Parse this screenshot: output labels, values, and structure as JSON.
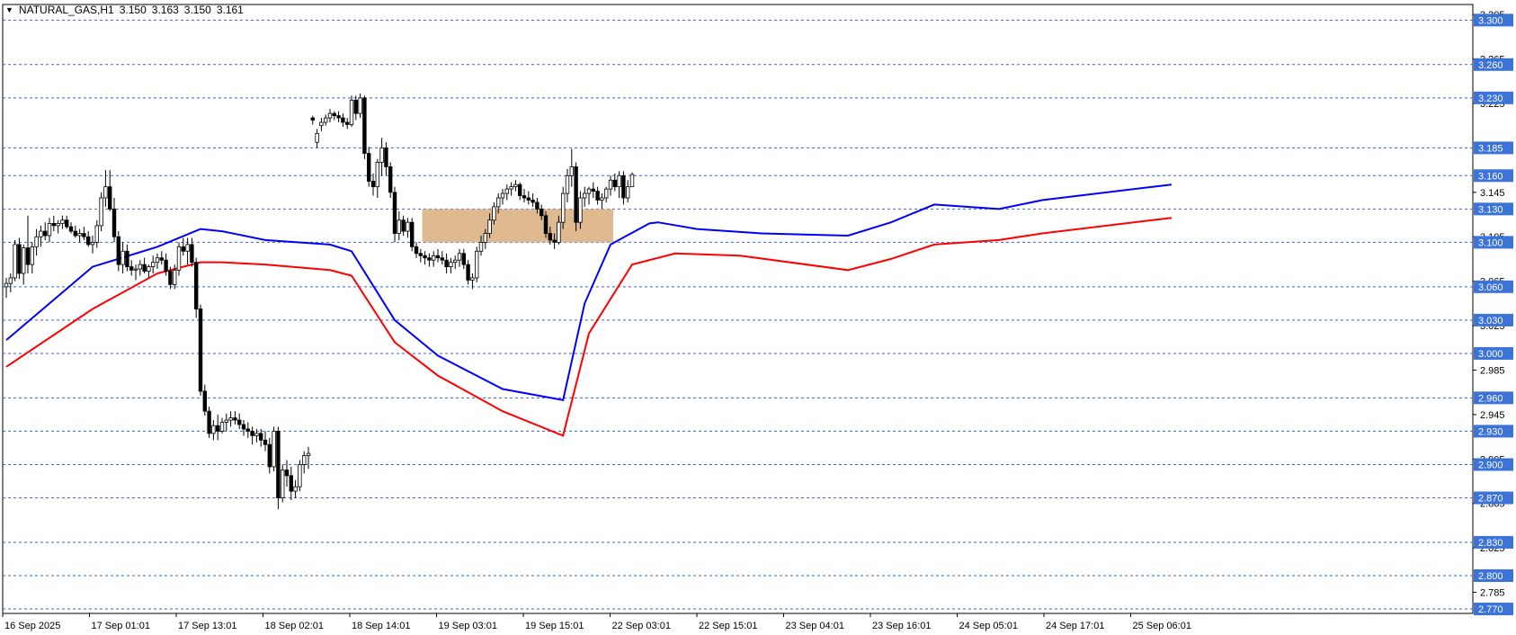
{
  "header": {
    "symbol": "NATURAL_GAS,H1",
    "open": "3.150",
    "high": "3.163",
    "low": "3.150",
    "close": "3.161"
  },
  "colors": {
    "background": "#ffffff",
    "candle_up_fill": "#ffffff",
    "candle_down_fill": "#000000",
    "candle_border": "#000000",
    "ema_fast": "#0000ff",
    "ema_slow": "#ff0000",
    "level_line": "#3b62c7",
    "level_label_bg": "#3b73d9",
    "zone_fill": "#d9ae7c"
  },
  "chart_data": {
    "type": "candlestick",
    "timeframe": "H1",
    "ylim": [
      2.766,
      3.31
    ],
    "y_ticks": [
      "3.305",
      "3.265",
      "3.225",
      "3.145",
      "3.105",
      "3.065",
      "3.025",
      "2.985",
      "2.945",
      "2.905",
      "2.865",
      "2.825",
      "2.785"
    ],
    "levels": [
      "3.300",
      "3.260",
      "3.230",
      "3.185",
      "3.160",
      "3.130",
      "3.100",
      "3.060",
      "3.030",
      "3.000",
      "2.960",
      "2.930",
      "2.900",
      "2.870",
      "2.830",
      "2.800",
      "2.770"
    ],
    "x_tick_labels": [
      "16 Sep 2025",
      "17 Sep 01:01",
      "17 Sep 13:01",
      "18 Sep 02:01",
      "18 Sep 14:01",
      "19 Sep 03:01",
      "19 Sep 15:01",
      "22 Sep 03:01",
      "22 Sep 15:01",
      "23 Sep 04:01",
      "23 Sep 16:01",
      "24 Sep 05:01",
      "24 Sep 17:01",
      "25 Sep 06:01"
    ],
    "zone": {
      "low": 3.1,
      "high": 3.13,
      "start_bar": 97,
      "end_bar": 140
    },
    "candles": [
      [
        3.06,
        3.068,
        3.05,
        3.063
      ],
      [
        3.063,
        3.072,
        3.055,
        3.068
      ],
      [
        3.068,
        3.102,
        3.065,
        3.098
      ],
      [
        3.098,
        3.104,
        3.067,
        3.072
      ],
      [
        3.072,
        3.098,
        3.062,
        3.095
      ],
      [
        3.095,
        3.124,
        3.072,
        3.08
      ],
      [
        3.08,
        3.1,
        3.072,
        3.096
      ],
      [
        3.096,
        3.112,
        3.088,
        3.105
      ],
      [
        3.105,
        3.115,
        3.096,
        3.11
      ],
      [
        3.11,
        3.118,
        3.102,
        3.106
      ],
      [
        3.106,
        3.122,
        3.1,
        3.117
      ],
      [
        3.117,
        3.124,
        3.11,
        3.115
      ],
      [
        3.115,
        3.12,
        3.108,
        3.117
      ],
      [
        3.117,
        3.124,
        3.112,
        3.12
      ],
      [
        3.12,
        3.124,
        3.112,
        3.114
      ],
      [
        3.114,
        3.118,
        3.108,
        3.11
      ],
      [
        3.11,
        3.115,
        3.104,
        3.106
      ],
      [
        3.106,
        3.112,
        3.1,
        3.108
      ],
      [
        3.108,
        3.114,
        3.102,
        3.105
      ],
      [
        3.105,
        3.11,
        3.096,
        3.098
      ],
      [
        3.098,
        3.106,
        3.09,
        3.1
      ],
      [
        3.1,
        3.12,
        3.095,
        3.115
      ],
      [
        3.115,
        3.145,
        3.11,
        3.14
      ],
      [
        3.14,
        3.165,
        3.132,
        3.15
      ],
      [
        3.15,
        3.165,
        3.128,
        3.13
      ],
      [
        3.13,
        3.14,
        3.1,
        3.105
      ],
      [
        3.105,
        3.11,
        3.074,
        3.08
      ],
      [
        3.08,
        3.1,
        3.072,
        3.092
      ],
      [
        3.092,
        3.098,
        3.074,
        3.078
      ],
      [
        3.078,
        3.084,
        3.07,
        3.075
      ],
      [
        3.075,
        3.08,
        3.066,
        3.076
      ],
      [
        3.076,
        3.084,
        3.07,
        3.08
      ],
      [
        3.08,
        3.086,
        3.072,
        3.074
      ],
      [
        3.074,
        3.08,
        3.068,
        3.078
      ],
      [
        3.078,
        3.088,
        3.072,
        3.082
      ],
      [
        3.082,
        3.09,
        3.076,
        3.086
      ],
      [
        3.086,
        3.092,
        3.08,
        3.084
      ],
      [
        3.084,
        3.09,
        3.07,
        3.074
      ],
      [
        3.074,
        3.078,
        3.058,
        3.062
      ],
      [
        3.062,
        3.08,
        3.058,
        3.075
      ],
      [
        3.075,
        3.1,
        3.07,
        3.096
      ],
      [
        3.096,
        3.104,
        3.088,
        3.092
      ],
      [
        3.092,
        3.104,
        3.08,
        3.098
      ],
      [
        3.098,
        3.104,
        3.078,
        3.082
      ],
      [
        3.082,
        3.086,
        3.032,
        3.04
      ],
      [
        3.04,
        3.044,
        2.962,
        2.966
      ],
      [
        2.966,
        2.972,
        2.944,
        2.948
      ],
      [
        2.948,
        2.952,
        2.924,
        2.928
      ],
      [
        2.928,
        2.94,
        2.922,
        2.935
      ],
      [
        2.935,
        2.945,
        2.922,
        2.93
      ],
      [
        2.93,
        2.942,
        2.928,
        2.938
      ],
      [
        2.938,
        2.946,
        2.93,
        2.94
      ],
      [
        2.94,
        2.948,
        2.934,
        2.942
      ],
      [
        2.942,
        2.948,
        2.936,
        2.94
      ],
      [
        2.94,
        2.946,
        2.932,
        2.936
      ],
      [
        2.936,
        2.94,
        2.926,
        2.932
      ],
      [
        2.932,
        2.938,
        2.924,
        2.93
      ],
      [
        2.93,
        2.934,
        2.918,
        2.926
      ],
      [
        2.926,
        2.932,
        2.92,
        2.928
      ],
      [
        2.928,
        2.932,
        2.916,
        2.922
      ],
      [
        2.922,
        2.93,
        2.912,
        2.918
      ],
      [
        2.918,
        2.924,
        2.892,
        2.898
      ],
      [
        2.898,
        2.934,
        2.894,
        2.93
      ],
      [
        2.93,
        2.934,
        2.86,
        2.87
      ],
      [
        2.87,
        2.9,
        2.866,
        2.895
      ],
      [
        2.895,
        2.904,
        2.88,
        2.89
      ],
      [
        2.89,
        2.898,
        2.868,
        2.876
      ],
      [
        2.876,
        2.886,
        2.87,
        2.88
      ],
      [
        2.88,
        2.904,
        2.876,
        2.9
      ],
      [
        2.9,
        2.912,
        2.892,
        2.908
      ],
      [
        2.908,
        2.916,
        2.896,
        2.91
      ],
      [
        3.212,
        3.214,
        3.206,
        3.21
      ],
      [
        3.19,
        3.202,
        3.185,
        3.198
      ],
      [
        3.205,
        3.212,
        3.2,
        3.208
      ],
      [
        3.208,
        3.215,
        3.205,
        3.212
      ],
      [
        3.212,
        3.22,
        3.208,
        3.216
      ],
      [
        3.216,
        3.218,
        3.21,
        3.214
      ],
      [
        3.214,
        3.218,
        3.208,
        3.212
      ],
      [
        3.212,
        3.216,
        3.204,
        3.208
      ],
      [
        3.208,
        3.212,
        3.202,
        3.206
      ],
      [
        3.206,
        3.232,
        3.204,
        3.228
      ],
      [
        3.228,
        3.232,
        3.21,
        3.216
      ],
      [
        3.216,
        3.234,
        3.212,
        3.23
      ],
      [
        3.23,
        3.232,
        3.175,
        3.18
      ],
      [
        3.18,
        3.186,
        3.15,
        3.155
      ],
      [
        3.155,
        3.162,
        3.142,
        3.15
      ],
      [
        3.15,
        3.175,
        3.14,
        3.172
      ],
      [
        3.172,
        3.194,
        3.16,
        3.185
      ],
      [
        3.185,
        3.19,
        3.16,
        3.168
      ],
      [
        3.168,
        3.172,
        3.14,
        3.145
      ],
      [
        3.145,
        3.15,
        3.1,
        3.108
      ],
      [
        3.108,
        3.128,
        3.102,
        3.12
      ],
      [
        3.12,
        3.124,
        3.106,
        3.11
      ],
      [
        3.11,
        3.122,
        3.104,
        3.118
      ],
      [
        3.118,
        3.122,
        3.092,
        3.096
      ],
      [
        3.096,
        3.1,
        3.086,
        3.09
      ],
      [
        3.09,
        3.094,
        3.082,
        3.088
      ],
      [
        3.088,
        3.092,
        3.08,
        3.086
      ],
      [
        3.086,
        3.09,
        3.078,
        3.084
      ],
      [
        3.084,
        3.092,
        3.078,
        3.088
      ],
      [
        3.088,
        3.094,
        3.082,
        3.086
      ],
      [
        3.086,
        3.092,
        3.08,
        3.084
      ],
      [
        3.084,
        3.09,
        3.072,
        3.078
      ],
      [
        3.078,
        3.086,
        3.072,
        3.082
      ],
      [
        3.082,
        3.088,
        3.076,
        3.084
      ],
      [
        3.084,
        3.094,
        3.078,
        3.09
      ],
      [
        3.09,
        3.094,
        3.076,
        3.08
      ],
      [
        3.08,
        3.084,
        3.062,
        3.066
      ],
      [
        3.066,
        3.072,
        3.058,
        3.068
      ],
      [
        3.068,
        3.096,
        3.064,
        3.092
      ],
      [
        3.092,
        3.106,
        3.088,
        3.1
      ],
      [
        3.1,
        3.112,
        3.094,
        3.108
      ],
      [
        3.108,
        3.126,
        3.104,
        3.12
      ],
      [
        3.12,
        3.136,
        3.116,
        3.132
      ],
      [
        3.132,
        3.144,
        3.126,
        3.14
      ],
      [
        3.14,
        3.148,
        3.134,
        3.144
      ],
      [
        3.144,
        3.152,
        3.138,
        3.148
      ],
      [
        3.148,
        3.154,
        3.142,
        3.15
      ],
      [
        3.15,
        3.156,
        3.146,
        3.152
      ],
      [
        3.152,
        3.154,
        3.138,
        3.142
      ],
      [
        3.142,
        3.148,
        3.136,
        3.14
      ],
      [
        3.14,
        3.146,
        3.134,
        3.138
      ],
      [
        3.138,
        3.144,
        3.132,
        3.136
      ],
      [
        3.136,
        3.14,
        3.126,
        3.13
      ],
      [
        3.13,
        3.134,
        3.12,
        3.124
      ],
      [
        3.124,
        3.128,
        3.104,
        3.108
      ],
      [
        3.108,
        3.114,
        3.098,
        3.102
      ],
      [
        3.102,
        3.108,
        3.094,
        3.1
      ],
      [
        3.1,
        3.124,
        3.098,
        3.118
      ],
      [
        3.118,
        3.15,
        3.112,
        3.144
      ],
      [
        3.144,
        3.166,
        3.136,
        3.16
      ],
      [
        3.16,
        3.184,
        3.15,
        3.168
      ],
      [
        3.168,
        3.172,
        3.11,
        3.118
      ],
      [
        3.118,
        3.146,
        3.112,
        3.14
      ],
      [
        3.14,
        3.15,
        3.132,
        3.144
      ],
      [
        3.144,
        3.15,
        3.134,
        3.148
      ],
      [
        3.148,
        3.154,
        3.14,
        3.146
      ],
      [
        3.146,
        3.15,
        3.134,
        3.138
      ],
      [
        3.138,
        3.144,
        3.13,
        3.14
      ],
      [
        3.14,
        3.15,
        3.136,
        3.148
      ],
      [
        3.148,
        3.16,
        3.142,
        3.156
      ],
      [
        3.156,
        3.162,
        3.146,
        3.15
      ],
      [
        3.15,
        3.164,
        3.14,
        3.16
      ],
      [
        3.16,
        3.164,
        3.134,
        3.14
      ],
      [
        3.14,
        3.156,
        3.136,
        3.15
      ],
      [
        3.15,
        3.163,
        3.15,
        3.161
      ]
    ],
    "ema_fast": [
      [
        0,
        3.012
      ],
      [
        20,
        3.078
      ],
      [
        35,
        3.096
      ],
      [
        45,
        3.112
      ],
      [
        50,
        3.11
      ],
      [
        60,
        3.102
      ],
      [
        75,
        3.098
      ],
      [
        80,
        3.092
      ],
      [
        90,
        3.03
      ],
      [
        100,
        2.998
      ],
      [
        115,
        2.968
      ],
      [
        129,
        2.958
      ],
      [
        134,
        3.045
      ],
      [
        140,
        3.098
      ],
      [
        149,
        3.117
      ],
      [
        151,
        3.118
      ],
      [
        160,
        3.112
      ],
      [
        175,
        3.108
      ],
      [
        195,
        3.106
      ],
      [
        205,
        3.118
      ],
      [
        215,
        3.134
      ],
      [
        230,
        3.13
      ],
      [
        240,
        3.138
      ],
      [
        270,
        3.152
      ]
    ],
    "ema_slow": [
      [
        0,
        2.988
      ],
      [
        20,
        3.04
      ],
      [
        35,
        3.072
      ],
      [
        45,
        3.082
      ],
      [
        50,
        3.082
      ],
      [
        60,
        3.08
      ],
      [
        75,
        3.075
      ],
      [
        80,
        3.07
      ],
      [
        90,
        3.01
      ],
      [
        100,
        2.98
      ],
      [
        115,
        2.948
      ],
      [
        129,
        2.926
      ],
      [
        135,
        3.018
      ],
      [
        145,
        3.08
      ],
      [
        155,
        3.09
      ],
      [
        170,
        3.088
      ],
      [
        195,
        3.075
      ],
      [
        205,
        3.085
      ],
      [
        215,
        3.098
      ],
      [
        230,
        3.102
      ],
      [
        240,
        3.108
      ],
      [
        270,
        3.122
      ]
    ]
  }
}
